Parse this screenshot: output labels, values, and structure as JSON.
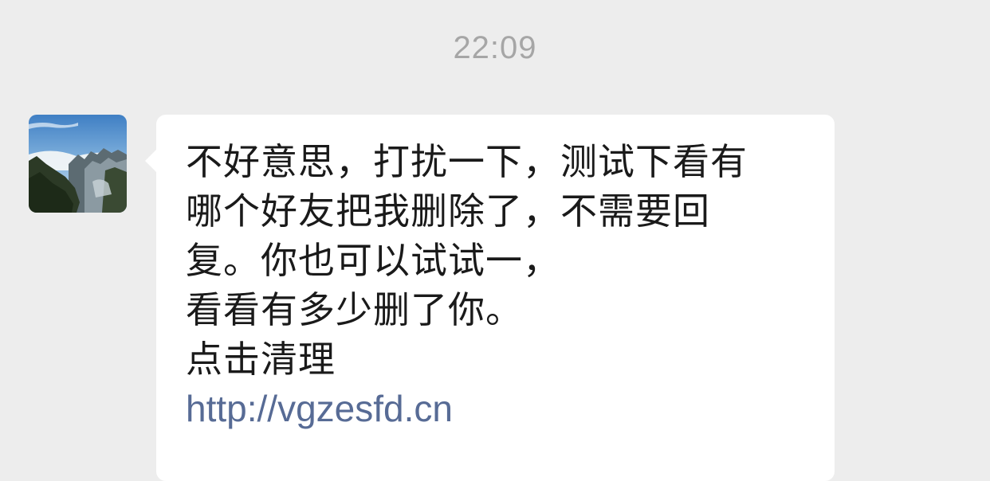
{
  "chat": {
    "timestamp": "22:09",
    "message": {
      "lines": [
        "不好意思，打扰一下，测试下看有",
        "哪个好友把我删除了，不需要回",
        "复。你也可以试试一，",
        "看看有多少删了你。",
        "点击清理"
      ],
      "link": "http://vgzesfd.cn"
    },
    "avatar": {
      "icon": "mountain-landscape-avatar"
    }
  },
  "colors": {
    "background": "#ededed",
    "bubble": "#ffffff",
    "text": "#1a1a1a",
    "timestamp": "#a6a6a6",
    "link": "#576b95"
  }
}
